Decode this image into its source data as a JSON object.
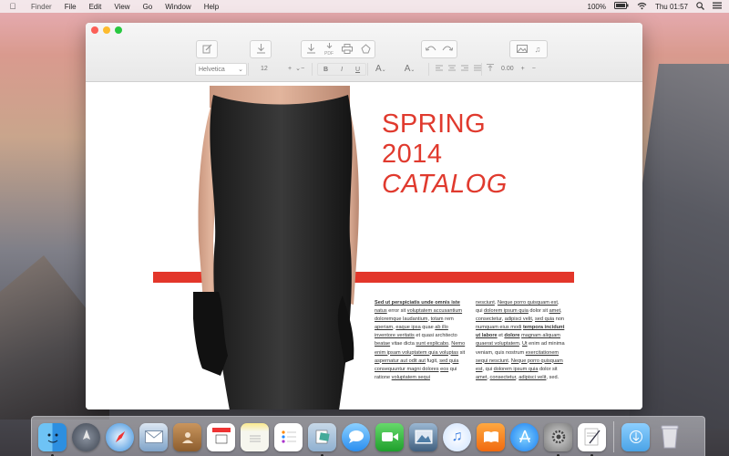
{
  "menubar": {
    "apple_icon": "apple-logo-icon",
    "app_name": "Finder",
    "menus": [
      "File",
      "Edit",
      "View",
      "Go",
      "Window",
      "Help"
    ],
    "battery": "100%",
    "clock": "Thu 01:57"
  },
  "toolbar": {
    "font_family": "Helvetica",
    "font_size": "12",
    "plus": "+",
    "minus": "−",
    "bold": "B",
    "italic": "I",
    "underline": "U",
    "font_color_a": "A",
    "highlight_a": "A",
    "line_spacing": "0.00",
    "pdf_label": "PDF"
  },
  "document": {
    "heading_line1": "SPRING",
    "heading_line2": "2014",
    "heading_line3": "CATALOG",
    "accent_color": "#e3362a"
  },
  "dock": {
    "items": [
      {
        "name": "Finder",
        "icon": "finder-icon"
      },
      {
        "name": "Launchpad",
        "icon": "launchpad-icon"
      },
      {
        "name": "Safari",
        "icon": "safari-icon"
      },
      {
        "name": "Mail",
        "icon": "mail-icon"
      },
      {
        "name": "Contacts",
        "icon": "contacts-icon"
      },
      {
        "name": "Calendar",
        "icon": "calendar-icon"
      },
      {
        "name": "Notes",
        "icon": "notes-icon"
      },
      {
        "name": "Reminders",
        "icon": "reminders-icon"
      },
      {
        "name": "Preview",
        "icon": "preview-icon"
      },
      {
        "name": "Messages",
        "icon": "messages-icon"
      },
      {
        "name": "FaceTime",
        "icon": "facetime-icon"
      },
      {
        "name": "Photo",
        "icon": "photo-icon"
      },
      {
        "name": "iTunes",
        "icon": "itunes-icon"
      },
      {
        "name": "iBooks",
        "icon": "ibooks-icon"
      },
      {
        "name": "App Store",
        "icon": "appstore-icon"
      },
      {
        "name": "System Preferences",
        "icon": "system-preferences-icon"
      },
      {
        "name": "TextEdit",
        "icon": "textedit-icon"
      },
      {
        "name": "Downloads",
        "icon": "downloads-folder-icon"
      },
      {
        "name": "Trash",
        "icon": "trash-icon"
      }
    ]
  }
}
